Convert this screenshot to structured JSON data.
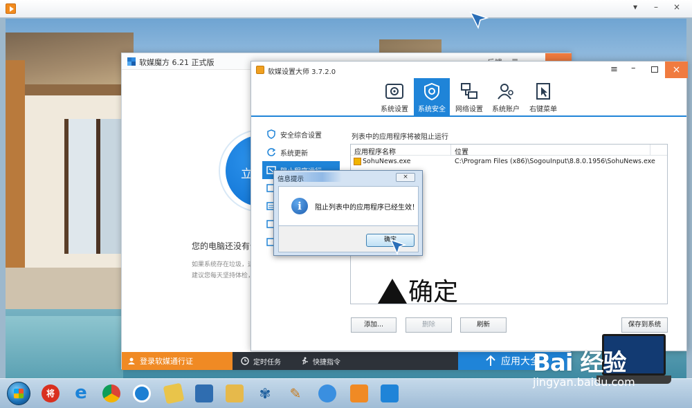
{
  "outer": {
    "controls": [
      "▾",
      "–",
      "×"
    ]
  },
  "back_window": {
    "title": "软媒魔方 6.21 正式版",
    "feedback": "反馈",
    "menu_icon": "≡",
    "circle_label": "立",
    "status_text": "您的电脑还没有优",
    "hint_line1": "如果系统存在垃圾，运",
    "hint_line2": "建议您每天坚持体检，",
    "login": "登录软媒通行证",
    "timer": "定时任务",
    "shortcut": "快捷指令",
    "apps": "应用大全"
  },
  "front_window": {
    "title": "软媒设置大师 3.7.2.0",
    "menu": "≡",
    "minimize": "–",
    "close": "×",
    "toolbar": [
      {
        "label": "系统设置",
        "icon": "gear-icon"
      },
      {
        "label": "系统安全",
        "icon": "shield-gear-icon"
      },
      {
        "label": "网络设置",
        "icon": "network-icon"
      },
      {
        "label": "系统账户",
        "icon": "users-icon"
      },
      {
        "label": "右键菜单",
        "icon": "context-menu-icon"
      }
    ],
    "sidebar": [
      {
        "label": "安全综合设置",
        "icon": "shield-icon"
      },
      {
        "label": "系统更新",
        "icon": "refresh-icon"
      },
      {
        "label": "阻止程序运行",
        "icon": "block-window-icon"
      }
    ],
    "caption": "列表中的应用程序将被阻止运行",
    "columns": [
      "应用程序名称",
      "位置"
    ],
    "rows": [
      {
        "name": "SohuNews.exe",
        "path": "C:\\Program Files (x86)\\SogouInput\\8.8.0.1956\\SohuNews.exe"
      }
    ],
    "buttons": {
      "add": "添加...",
      "delete": "删除",
      "refresh": "刷新",
      "save": "保存到系统"
    }
  },
  "annotation": {
    "text": "确定"
  },
  "dialog": {
    "title": "信息提示",
    "close": "×",
    "icon": "info-icon",
    "message": "阻止列表中的应用程序已经生效！",
    "ok": "确定"
  },
  "watermark": {
    "logo": "Bai 经验",
    "url": "jingyan.baidu.com"
  },
  "colors": {
    "accent_blue": "#1f84d8",
    "close_orange": "#f07b3f",
    "login_orange": "#f08a24",
    "bottom_dark": "#2d3239"
  }
}
